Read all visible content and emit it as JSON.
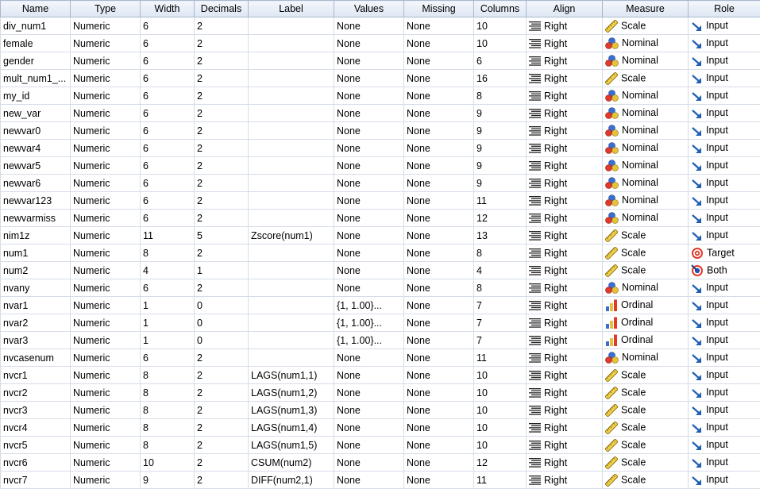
{
  "columns": [
    "Name",
    "Type",
    "Width",
    "Decimals",
    "Label",
    "Values",
    "Missing",
    "Columns",
    "Align",
    "Measure",
    "Role"
  ],
  "rows": [
    {
      "name": "div_num1",
      "type": "Numeric",
      "width": "6",
      "decimals": "2",
      "label": "",
      "values": "None",
      "missing": "None",
      "columns": "10",
      "align": "Right",
      "measure": "Scale",
      "role": "Input"
    },
    {
      "name": "female",
      "type": "Numeric",
      "width": "6",
      "decimals": "2",
      "label": "",
      "values": "None",
      "missing": "None",
      "columns": "10",
      "align": "Right",
      "measure": "Nominal",
      "role": "Input"
    },
    {
      "name": "gender",
      "type": "Numeric",
      "width": "6",
      "decimals": "2",
      "label": "",
      "values": "None",
      "missing": "None",
      "columns": "6",
      "align": "Right",
      "measure": "Nominal",
      "role": "Input"
    },
    {
      "name": "mult_num1_...",
      "type": "Numeric",
      "width": "6",
      "decimals": "2",
      "label": "",
      "values": "None",
      "missing": "None",
      "columns": "16",
      "align": "Right",
      "measure": "Scale",
      "role": "Input"
    },
    {
      "name": "my_id",
      "type": "Numeric",
      "width": "6",
      "decimals": "2",
      "label": "",
      "values": "None",
      "missing": "None",
      "columns": "8",
      "align": "Right",
      "measure": "Nominal",
      "role": "Input"
    },
    {
      "name": "new_var",
      "type": "Numeric",
      "width": "6",
      "decimals": "2",
      "label": "",
      "values": "None",
      "missing": "None",
      "columns": "9",
      "align": "Right",
      "measure": "Nominal",
      "role": "Input"
    },
    {
      "name": "newvar0",
      "type": "Numeric",
      "width": "6",
      "decimals": "2",
      "label": "",
      "values": "None",
      "missing": "None",
      "columns": "9",
      "align": "Right",
      "measure": "Nominal",
      "role": "Input"
    },
    {
      "name": "newvar4",
      "type": "Numeric",
      "width": "6",
      "decimals": "2",
      "label": "",
      "values": "None",
      "missing": "None",
      "columns": "9",
      "align": "Right",
      "measure": "Nominal",
      "role": "Input"
    },
    {
      "name": "newvar5",
      "type": "Numeric",
      "width": "6",
      "decimals": "2",
      "label": "",
      "values": "None",
      "missing": "None",
      "columns": "9",
      "align": "Right",
      "measure": "Nominal",
      "role": "Input"
    },
    {
      "name": "newvar6",
      "type": "Numeric",
      "width": "6",
      "decimals": "2",
      "label": "",
      "values": "None",
      "missing": "None",
      "columns": "9",
      "align": "Right",
      "measure": "Nominal",
      "role": "Input"
    },
    {
      "name": "newvar123",
      "type": "Numeric",
      "width": "6",
      "decimals": "2",
      "label": "",
      "values": "None",
      "missing": "None",
      "columns": "11",
      "align": "Right",
      "measure": "Nominal",
      "role": "Input"
    },
    {
      "name": "newvarmiss",
      "type": "Numeric",
      "width": "6",
      "decimals": "2",
      "label": "",
      "values": "None",
      "missing": "None",
      "columns": "12",
      "align": "Right",
      "measure": "Nominal",
      "role": "Input"
    },
    {
      "name": "nim1z",
      "type": "Numeric",
      "width": "11",
      "decimals": "5",
      "label": "Zscore(num1)",
      "values": "None",
      "missing": "None",
      "columns": "13",
      "align": "Right",
      "measure": "Scale",
      "role": "Input"
    },
    {
      "name": "num1",
      "type": "Numeric",
      "width": "8",
      "decimals": "2",
      "label": "",
      "values": "None",
      "missing": "None",
      "columns": "8",
      "align": "Right",
      "measure": "Scale",
      "role": "Target"
    },
    {
      "name": "num2",
      "type": "Numeric",
      "width": "4",
      "decimals": "1",
      "label": "",
      "values": "None",
      "missing": "None",
      "columns": "4",
      "align": "Right",
      "measure": "Scale",
      "role": "Both"
    },
    {
      "name": "nvany",
      "type": "Numeric",
      "width": "6",
      "decimals": "2",
      "label": "",
      "values": "None",
      "missing": "None",
      "columns": "8",
      "align": "Right",
      "measure": "Nominal",
      "role": "Input"
    },
    {
      "name": "nvar1",
      "type": "Numeric",
      "width": "1",
      "decimals": "0",
      "label": "",
      "values": "{1, 1.00}...",
      "missing": "None",
      "columns": "7",
      "align": "Right",
      "measure": "Ordinal",
      "role": "Input"
    },
    {
      "name": "nvar2",
      "type": "Numeric",
      "width": "1",
      "decimals": "0",
      "label": "",
      "values": "{1, 1.00}...",
      "missing": "None",
      "columns": "7",
      "align": "Right",
      "measure": "Ordinal",
      "role": "Input"
    },
    {
      "name": "nvar3",
      "type": "Numeric",
      "width": "1",
      "decimals": "0",
      "label": "",
      "values": "{1, 1.00}...",
      "missing": "None",
      "columns": "7",
      "align": "Right",
      "measure": "Ordinal",
      "role": "Input"
    },
    {
      "name": "nvcasenum",
      "type": "Numeric",
      "width": "6",
      "decimals": "2",
      "label": "",
      "values": "None",
      "missing": "None",
      "columns": "11",
      "align": "Right",
      "measure": "Nominal",
      "role": "Input"
    },
    {
      "name": "nvcr1",
      "type": "Numeric",
      "width": "8",
      "decimals": "2",
      "label": "LAGS(num1,1)",
      "values": "None",
      "missing": "None",
      "columns": "10",
      "align": "Right",
      "measure": "Scale",
      "role": "Input"
    },
    {
      "name": "nvcr2",
      "type": "Numeric",
      "width": "8",
      "decimals": "2",
      "label": "LAGS(num1,2)",
      "values": "None",
      "missing": "None",
      "columns": "10",
      "align": "Right",
      "measure": "Scale",
      "role": "Input"
    },
    {
      "name": "nvcr3",
      "type": "Numeric",
      "width": "8",
      "decimals": "2",
      "label": "LAGS(num1,3)",
      "values": "None",
      "missing": "None",
      "columns": "10",
      "align": "Right",
      "measure": "Scale",
      "role": "Input"
    },
    {
      "name": "nvcr4",
      "type": "Numeric",
      "width": "8",
      "decimals": "2",
      "label": "LAGS(num1,4)",
      "values": "None",
      "missing": "None",
      "columns": "10",
      "align": "Right",
      "measure": "Scale",
      "role": "Input"
    },
    {
      "name": "nvcr5",
      "type": "Numeric",
      "width": "8",
      "decimals": "2",
      "label": "LAGS(num1,5)",
      "values": "None",
      "missing": "None",
      "columns": "10",
      "align": "Right",
      "measure": "Scale",
      "role": "Input"
    },
    {
      "name": "nvcr6",
      "type": "Numeric",
      "width": "10",
      "decimals": "2",
      "label": "CSUM(num2)",
      "values": "None",
      "missing": "None",
      "columns": "12",
      "align": "Right",
      "measure": "Scale",
      "role": "Input"
    },
    {
      "name": "nvcr7",
      "type": "Numeric",
      "width": "9",
      "decimals": "2",
      "label": "DIFF(num2,1)",
      "values": "None",
      "missing": "None",
      "columns": "11",
      "align": "Right",
      "measure": "Scale",
      "role": "Input"
    }
  ],
  "icons": {
    "align": "align-right-icon",
    "Scale": "ruler-icon",
    "Nominal": "nominal-balls-icon",
    "Ordinal": "ordinal-bars-icon",
    "Input": "arrow-input-icon",
    "Target": "target-icon",
    "Both": "both-icon"
  }
}
